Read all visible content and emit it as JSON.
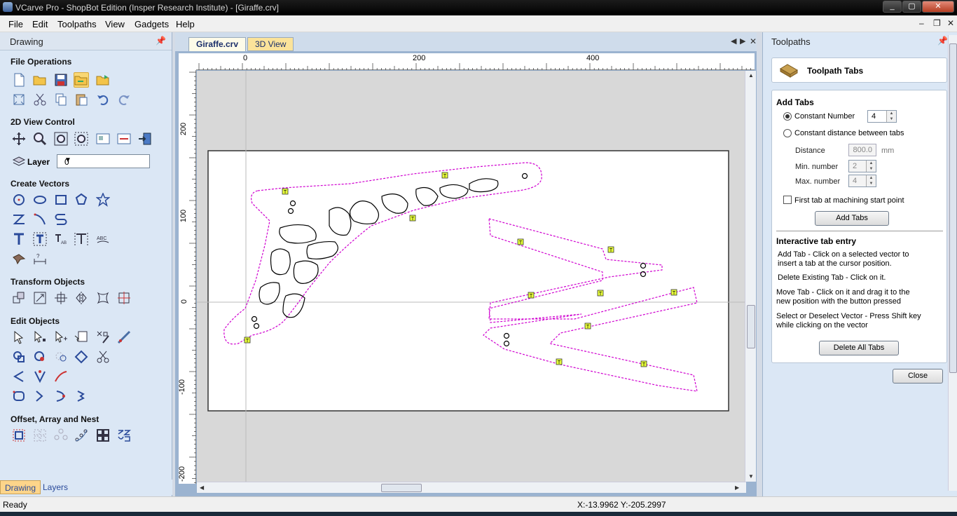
{
  "window": {
    "title": "VCarve Pro - ShopBot Edition (Insper Research Institute) - [Giraffe.crv]"
  },
  "menu": {
    "items": [
      "File",
      "Edit",
      "Toolpaths",
      "View",
      "Gadgets",
      "Help"
    ]
  },
  "left_panel": {
    "title": "Drawing",
    "sections": {
      "file_ops": "File Operations",
      "view_control": "2D View Control",
      "create_vectors": "Create Vectors",
      "transform": "Transform Objects",
      "edit": "Edit Objects",
      "offset": "Offset, Array and Nest"
    },
    "layer_label": "Layer",
    "layer_value": "0",
    "tabs": [
      "Drawing",
      "Layers"
    ]
  },
  "document": {
    "tabs": [
      "Giraffe.crv",
      "3D View"
    ],
    "ruler_h": [
      "0",
      "200",
      "400"
    ],
    "ruler_v": [
      "200",
      "100",
      "0",
      "-100",
      "-200"
    ],
    "tab_marker": "T"
  },
  "right_panel": {
    "title": "Toolpaths",
    "header": "Toolpath Tabs",
    "add_tabs": {
      "title": "Add Tabs",
      "constant_number_label": "Constant Number",
      "constant_number_value": "4",
      "constant_distance_label": "Constant distance between tabs",
      "distance_label": "Distance",
      "distance_value": "800.0",
      "distance_unit": "mm",
      "min_label": "Min. number",
      "min_value": "2",
      "max_label": "Max. number",
      "max_value": "4",
      "first_tab_label": "First tab at machining start point",
      "add_button": "Add Tabs"
    },
    "interactive": {
      "title": "Interactive tab entry",
      "add_line1": "Add Tab - Click on a selected vector to",
      "add_line2": "insert a tab at the cursor position.",
      "delete": "Delete Existing Tab - Click on it.",
      "move_line1": "Move Tab - Click on it and drag it to the",
      "move_line2": "new position with the button pressed",
      "select_line1": "Select or Deselect Vector - Press Shift key",
      "select_line2": "while clicking on the vector",
      "delete_button": "Delete All Tabs"
    },
    "close_button": "Close"
  },
  "status": {
    "ready": "Ready",
    "coords": "X:-13.9962 Y:-205.2997"
  },
  "colors": {
    "toolpath": "#d000d0",
    "tab_fill": "#e8ff3a",
    "vector": "#000000"
  }
}
